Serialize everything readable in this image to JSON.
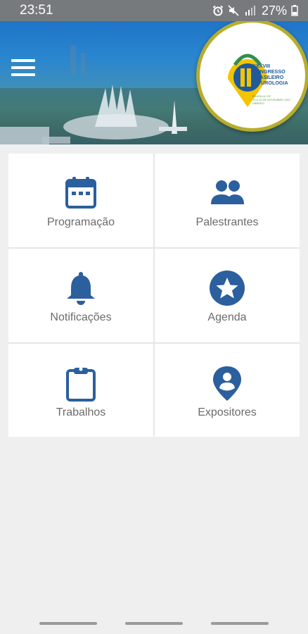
{
  "status_bar": {
    "time": "23:51",
    "battery_percent": "27%",
    "icons": [
      "alarm-icon",
      "mute-icon",
      "signal-icon",
      "battery-icon"
    ]
  },
  "header": {
    "menu_icon": "hamburger-menu-icon",
    "logo": {
      "title_lines": [
        "XXXVIII",
        "CONGRESSO",
        "BRASILEIRO",
        "DE UROLOGIA"
      ],
      "subtitle_lines": [
        "BRASÍLIA / DF",
        "13 A 16 DE NOVEMBRO 2021",
        "HÍBRIDO"
      ]
    }
  },
  "tiles": [
    {
      "label": "Programação",
      "icon": "calendar-icon"
    },
    {
      "label": "Palestrantes",
      "icon": "people-icon"
    },
    {
      "label": "Notificações",
      "icon": "bell-icon"
    },
    {
      "label": "Agenda",
      "icon": "star-circle-icon"
    },
    {
      "label": "Trabalhos",
      "icon": "clipboard-icon"
    },
    {
      "label": "Expositores",
      "icon": "location-pin-person-icon"
    }
  ],
  "colors": {
    "accent": "#2b5f9e",
    "status_bar": "#777a7d",
    "logo_ring": "#b7ad2d",
    "background": "#efefef"
  }
}
